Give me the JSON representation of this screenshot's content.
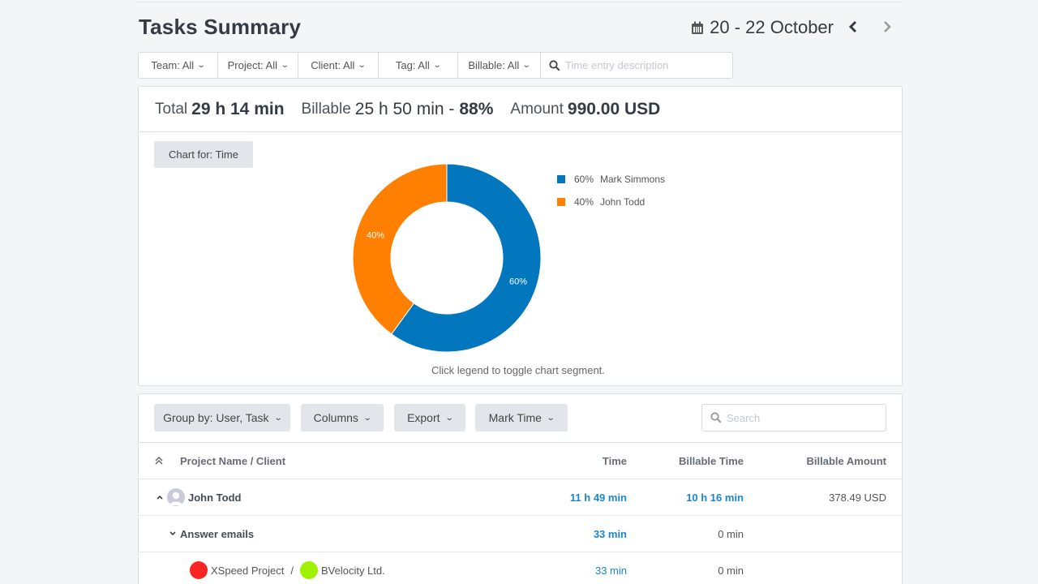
{
  "page": {
    "title": "Tasks Summary",
    "date_range": "20 - 22 October",
    "icons": {
      "calendar": "calendar-icon",
      "prev": "chevron-left-icon",
      "next": "chevron-right-icon"
    }
  },
  "filters": {
    "items": [
      {
        "label": "Team: All"
      },
      {
        "label": "Project: All"
      },
      {
        "label": "Client: All"
      },
      {
        "label": "Tag: All"
      },
      {
        "label": "Billable: All"
      }
    ],
    "description_placeholder": "Time entry description",
    "description_value": ""
  },
  "summary": {
    "total_label": "Total",
    "total_value": "29 h 14 min",
    "billable_label": "Billable",
    "billable_value": "25 h 50 min -",
    "billable_pct": "88%",
    "amount_label": "Amount",
    "amount_value": "990.00 USD"
  },
  "chart_controls": {
    "chart_for_label": "Chart for: Time",
    "hint": "Click legend to toggle chart segment."
  },
  "chart_data": {
    "type": "pie",
    "variant": "donut",
    "title": "",
    "slices": [
      {
        "name": "Mark Simmons",
        "value": 60,
        "label": "60%",
        "color": "#0277bd"
      },
      {
        "name": "John Todd",
        "value": 40,
        "label": "40%",
        "color": "#ff8000"
      }
    ],
    "legend": [
      {
        "pct": "60%",
        "name": "Mark Simmons"
      },
      {
        "pct": "40%",
        "name": "John Todd"
      }
    ],
    "legend_position": "right"
  },
  "toolbar": {
    "group_by_label": "Group by: User, Task",
    "columns_label": "Columns",
    "export_label": "Export",
    "mark_time_label": "Mark Time",
    "search_placeholder": "Search",
    "search_value": ""
  },
  "table": {
    "columns": {
      "name": "Project Name / Client",
      "time": "Time",
      "billable_time": "Billable Time",
      "billable_amount": "Billable Amount"
    },
    "user_row": {
      "name": "John Todd",
      "time": "11 h 49 min",
      "billable_time": "10 h 16 min",
      "billable_amount": "378.49 USD"
    },
    "task_row": {
      "name": "Answer emails",
      "time": "33 min",
      "billable_time": "0 min"
    },
    "project_row": {
      "project": "XSpeed Project",
      "separator": "/",
      "client": "BVelocity Ltd.",
      "project_color": "#f82525",
      "client_color": "#9ef200",
      "time": "33 min",
      "billable_time": "0 min"
    }
  }
}
